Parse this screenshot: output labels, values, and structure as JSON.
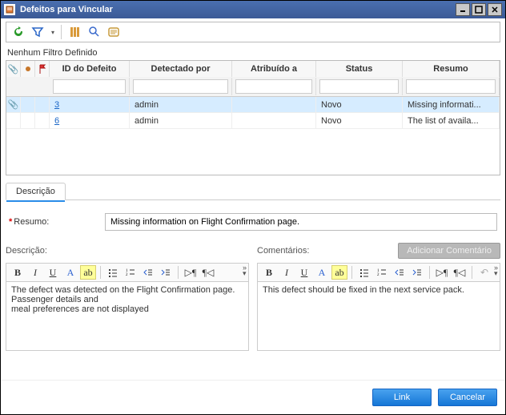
{
  "window": {
    "title": "Defeitos para Vincular"
  },
  "filter_status": "Nenhum Filtro Definido",
  "grid": {
    "columns": {
      "id": "ID do Defeito",
      "detected": "Detectado por",
      "assigned": "Atribuído a",
      "status": "Status",
      "summary": "Resumo"
    },
    "rows": [
      {
        "id": "3",
        "detected": "admin",
        "assigned": "",
        "status": "Novo",
        "summary": "Missing informati...",
        "selected": true,
        "has_attachment": true
      },
      {
        "id": "6",
        "detected": "admin",
        "assigned": "",
        "status": "Novo",
        "summary": "The list of availa...",
        "selected": false,
        "has_attachment": false
      }
    ]
  },
  "tabs": {
    "description": "Descrição"
  },
  "summary": {
    "label": "Resumo:",
    "value": "Missing information on Flight Confirmation page."
  },
  "left_panel": {
    "title": "Descrição:",
    "body": "The defect was detected on the Flight Confirmation page. Passenger details and\nmeal preferences are not displayed"
  },
  "right_panel": {
    "title": "Comentários:",
    "add_button": "Adicionar Comentário",
    "body": "This defect should be fixed in the next service pack."
  },
  "buttons": {
    "link": "Link",
    "cancel": "Cancelar"
  }
}
